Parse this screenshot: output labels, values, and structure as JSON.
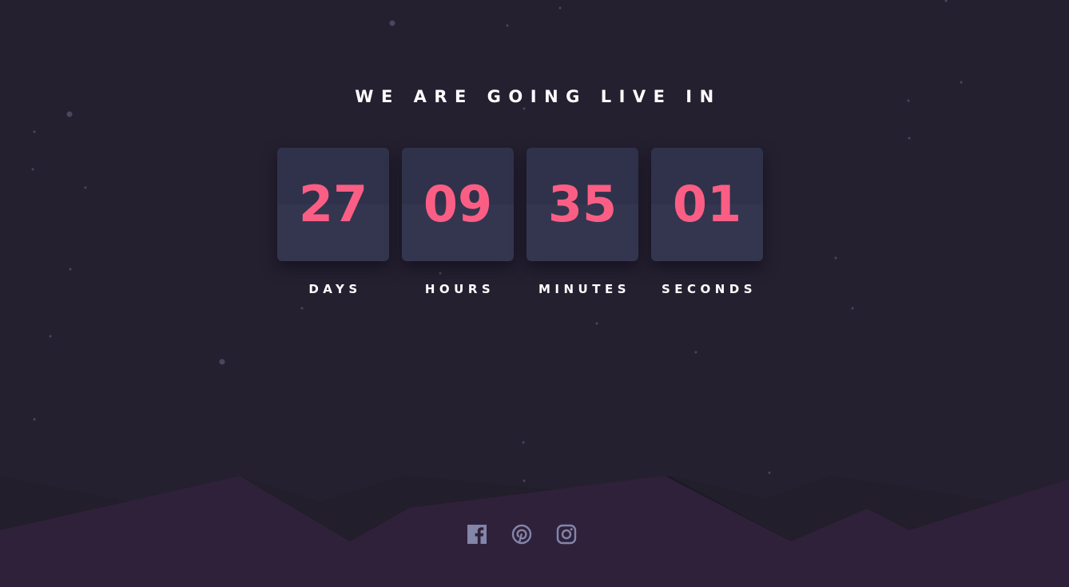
{
  "headline": "WE ARE GOING LIVE IN",
  "countdown": [
    {
      "value": "27",
      "label": "DAYS"
    },
    {
      "value": "09",
      "label": "HOURS"
    },
    {
      "value": "35",
      "label": "MINUTES"
    },
    {
      "value": "01",
      "label": "SECONDS"
    }
  ],
  "social": [
    {
      "icon": "facebook-icon"
    },
    {
      "icon": "pinterest-icon"
    },
    {
      "icon": "instagram-icon"
    }
  ],
  "colors": {
    "background": "#252030",
    "card": "#343650",
    "accent": "#fb5e84",
    "text": "#ffffff",
    "icon": "#8385a9",
    "hills_front": "#30213a",
    "hills_back": "#1e1a26"
  }
}
